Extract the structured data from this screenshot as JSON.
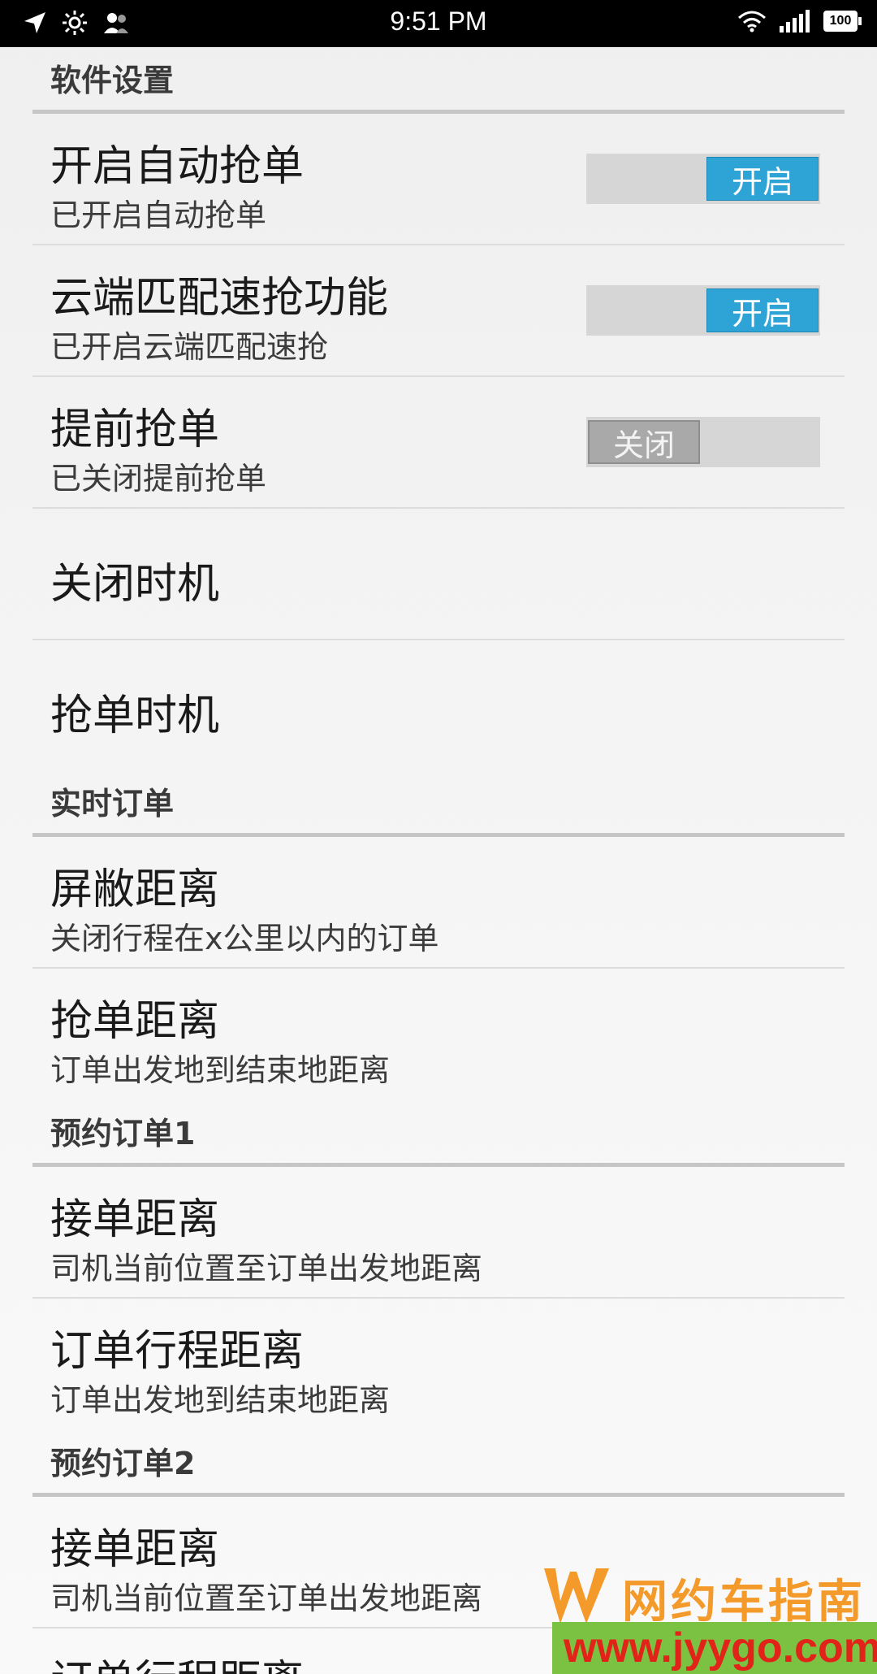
{
  "status_bar": {
    "time": "9:51 PM",
    "battery": "100"
  },
  "sections": {
    "software": {
      "header": "软件设置"
    },
    "realtime": {
      "header": "实时订单"
    },
    "reserve1": {
      "header": "预约订单1"
    },
    "reserve2": {
      "header": "预约订单2"
    }
  },
  "rows": [
    {
      "title": "开启自动抢单",
      "subtitle": "已开启自动抢单",
      "toggle": "开启",
      "on": true
    },
    {
      "title": "云端匹配速抢功能",
      "subtitle": "已开启云端匹配速抢",
      "toggle": "开启",
      "on": true
    },
    {
      "title": "提前抢单",
      "subtitle": "已关闭提前抢单",
      "toggle": "关闭",
      "on": false
    },
    {
      "title": "关闭时机"
    },
    {
      "title": "抢单时机"
    },
    {
      "title": "屏敝距离",
      "subtitle": "关闭行程在x公里以内的订单"
    },
    {
      "title": "抢单距离",
      "subtitle": "订单出发地到结束地距离"
    },
    {
      "title": "接单距离",
      "subtitle": "司机当前位置至订单出发地距离"
    },
    {
      "title": "订单行程距离",
      "subtitle": "订单出发地到结束地距离"
    },
    {
      "title": "接单距离",
      "subtitle": "司机当前位置至订单出发地距离"
    },
    {
      "title": "订单行程距离"
    }
  ],
  "watermark": {
    "brand": "网约车指南",
    "url": "www.jyygo.com"
  },
  "colors": {
    "accent": "#2ea3d6",
    "status_bar": "#000000",
    "watermark_orange": "#f39a2a",
    "watermark_green": "#7cc242",
    "watermark_red": "#e2231a"
  }
}
